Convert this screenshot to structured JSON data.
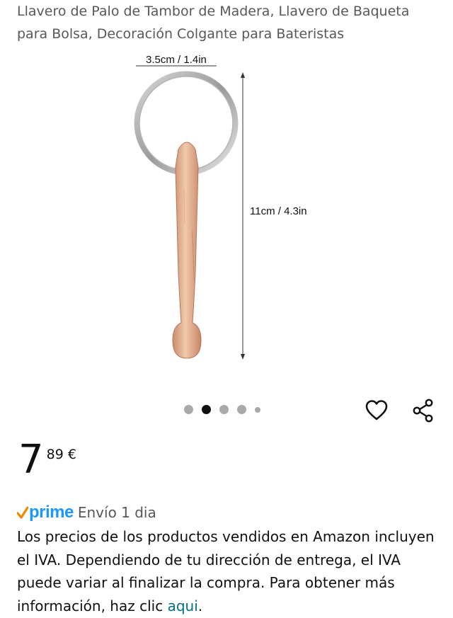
{
  "product": {
    "title": "Llavero de Palo de Tambor de Madera, Llavero de Baqueta para Bolsa, Decoración Colgante para Bateristas",
    "image": {
      "width_label": "3.5cm / 1.4in",
      "height_label": "11cm / 4.3in"
    },
    "carousel": {
      "total_dots": 5,
      "active_index": 1
    }
  },
  "price": {
    "whole": "7",
    "fraction": "89",
    "currency": "€"
  },
  "prime": {
    "logo": "prime",
    "delivery": "Envío 1 dia"
  },
  "vat_note": {
    "text": "Los precios de los productos vendidos en Amazon incluyen el IVA. Dependiendo de tu dirección de entrega, el IVA puede variar al finalizar la compra. Para obtener más información, haz clic ",
    "link_label": "aqui",
    "end": "."
  },
  "colors": {
    "prime_blue": "#1a98ff",
    "link_teal": "#007185"
  },
  "icons": [
    "heart-icon",
    "share-icon",
    "prime-check-icon"
  ]
}
